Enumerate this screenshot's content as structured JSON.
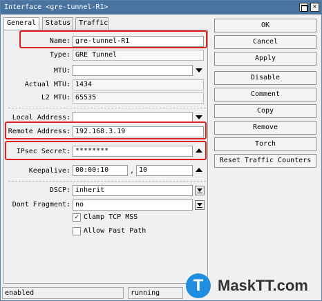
{
  "window": {
    "title": "Interface <gre-tunnel-R1>"
  },
  "tabs": [
    {
      "label": "General"
    },
    {
      "label": "Status"
    },
    {
      "label": "Traffic"
    }
  ],
  "general": {
    "name_label": "Name:",
    "name_value": "gre-tunnel-R1",
    "type_label": "Type:",
    "type_value": "GRE Tunnel",
    "mtu_label": "MTU:",
    "mtu_value": "",
    "actual_mtu_label": "Actual MTU:",
    "actual_mtu_value": "1434",
    "l2_mtu_label": "L2 MTU:",
    "l2_mtu_value": "65535",
    "local_address_label": "Local Address:",
    "local_address_value": "",
    "remote_address_label": "Remote Address:",
    "remote_address_value": "192.168.3.19",
    "ipsec_secret_label": "IPsec Secret:",
    "ipsec_secret_value": "********",
    "keepalive_label": "Keepalive:",
    "keepalive_interval": "00:00:10",
    "keepalive_separator": ",",
    "keepalive_retries": "10",
    "dscp_label": "DSCP:",
    "dscp_value": "inherit",
    "dont_fragment_label": "Dont Fragment:",
    "dont_fragment_value": "no",
    "clamp_tcp_mss_label": "Clamp TCP MSS",
    "clamp_tcp_mss_checked": true,
    "allow_fast_path_label": "Allow Fast Path",
    "allow_fast_path_checked": false
  },
  "buttons": {
    "ok": "OK",
    "cancel": "Cancel",
    "apply": "Apply",
    "disable": "Disable",
    "comment": "Comment",
    "copy": "Copy",
    "remove": "Remove",
    "torch": "Torch",
    "reset_traffic_counters": "Reset Traffic Counters"
  },
  "status_bar": {
    "state": "enabled",
    "running": "running"
  },
  "watermark": {
    "logo_letter": "T",
    "text": "MaskTT.com"
  },
  "colors": {
    "titlebar": "#4a74a0",
    "highlight": "#e02020",
    "watermark_blue": "#1f8de0"
  }
}
